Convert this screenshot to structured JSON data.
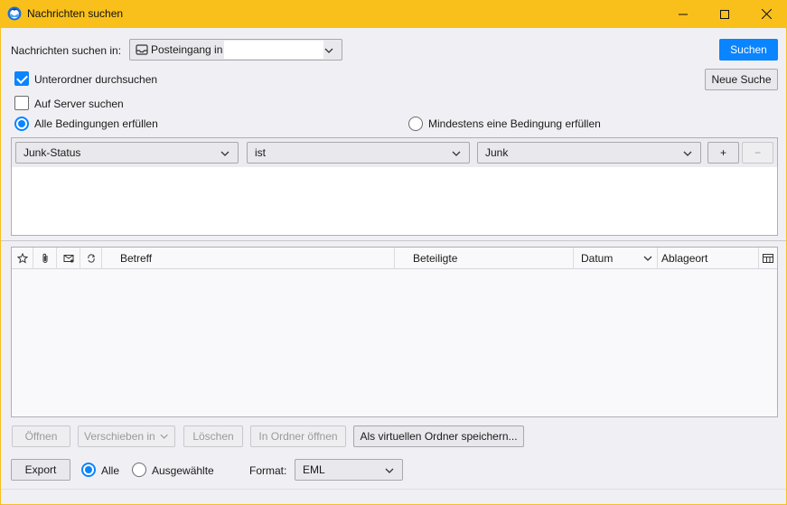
{
  "window": {
    "title": "Nachrichten suchen",
    "brand_color": "#f9c01b",
    "accent_color": "#0a84ff"
  },
  "search_in": {
    "label": "Nachrichten suchen in:",
    "folder_value": "Posteingang in",
    "search_button": "Suchen",
    "new_search_button": "Neue Suche"
  },
  "options": {
    "subfolders_label": "Unterordner durchsuchen",
    "subfolders_checked": true,
    "server_label": "Auf Server suchen",
    "server_checked": false,
    "all_conditions_label": "Alle Bedingungen erfüllen",
    "any_condition_label": "Mindestens eine Bedingung erfüllen",
    "selected_match": "all"
  },
  "condition": {
    "field": "Junk-Status",
    "operator": "ist",
    "value": "Junk",
    "add_label": "+",
    "remove_label": "−"
  },
  "results_table": {
    "columns": [
      "Betreff",
      "Beteiligte",
      "Datum",
      "Ablageort"
    ],
    "icon_columns": [
      "star-icon",
      "attachment-icon",
      "junk-icon",
      "thread-icon"
    ],
    "rows": []
  },
  "actions": {
    "open": "Öffnen",
    "move_to": "Verschieben in",
    "delete": "Löschen",
    "open_in_folder": "In Ordner öffnen",
    "save_virtual": "Als virtuellen Ordner speichern..."
  },
  "export": {
    "export_button": "Export",
    "all_label": "Alle",
    "selected_label": "Ausgewählte",
    "format_label": "Format:",
    "format_value": "EML",
    "selected_scope": "all"
  }
}
